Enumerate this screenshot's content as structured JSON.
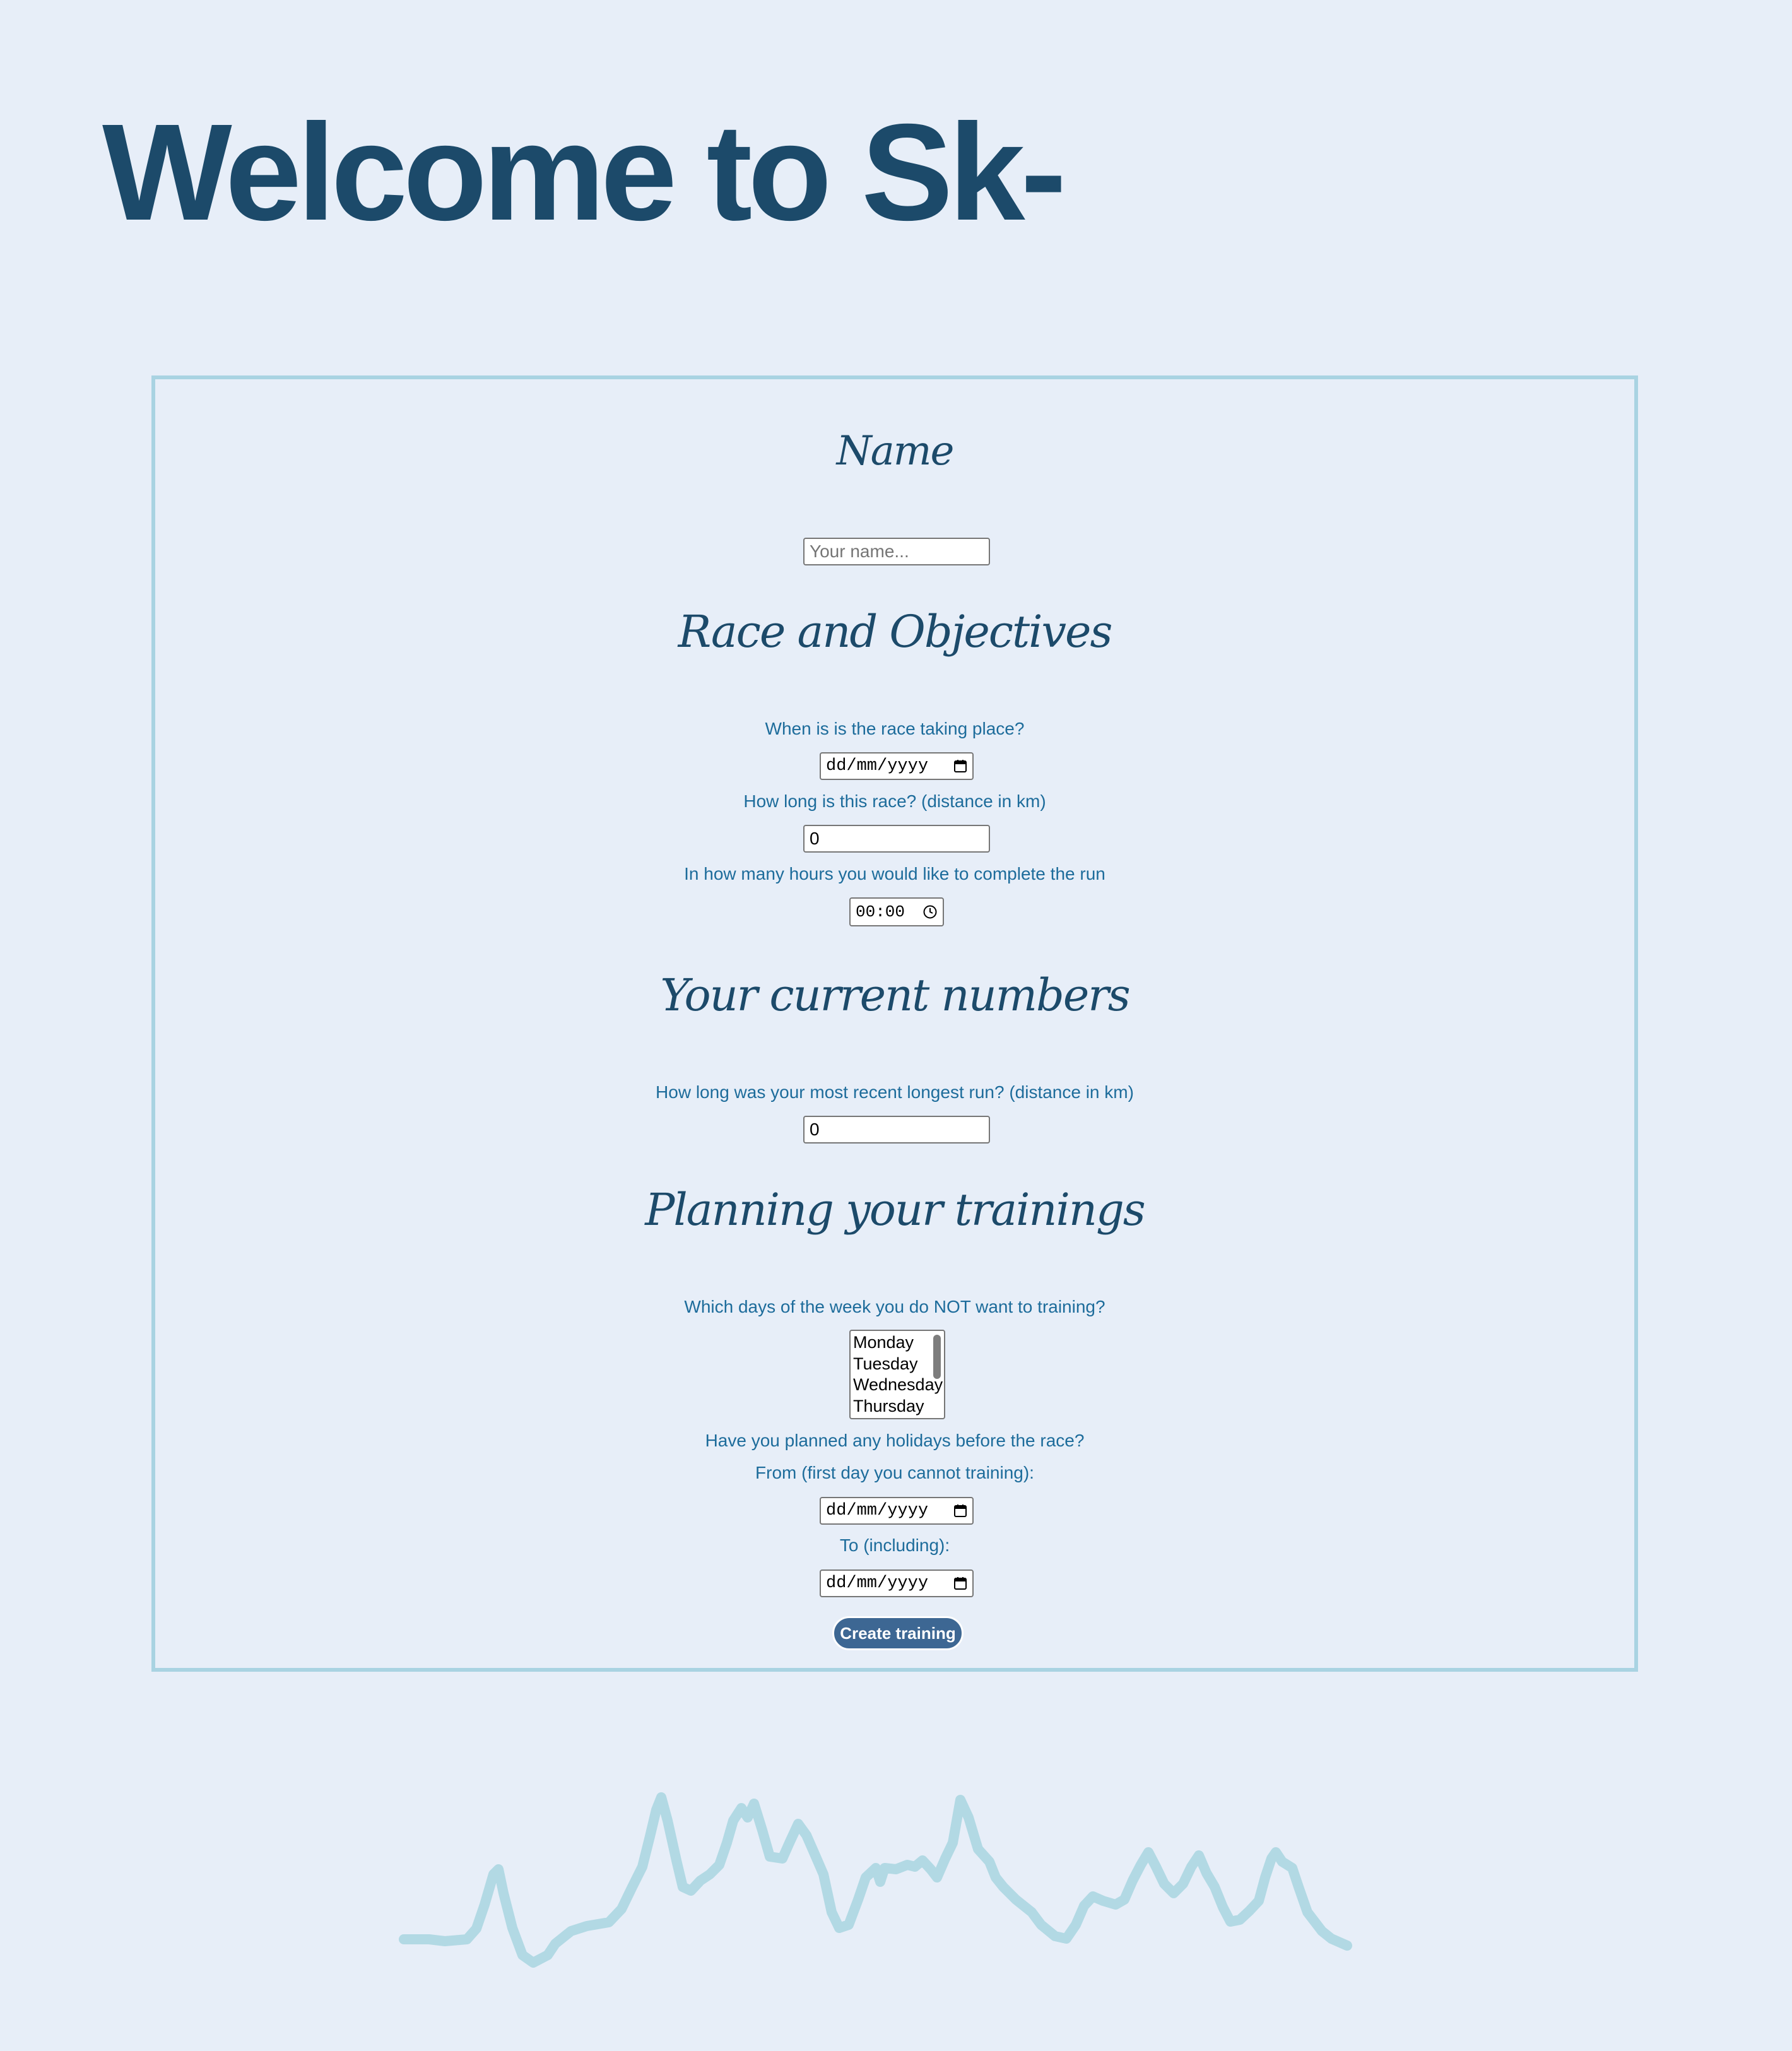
{
  "header": {
    "title": "Welcome to Sk-"
  },
  "form": {
    "name_section": {
      "heading": "Name",
      "name_placeholder": "Your name..."
    },
    "race_section": {
      "heading": "Race and Objectives",
      "date_label": "When is is the race taking place?",
      "date_value": "dd/mm/yyyy",
      "distance_label": "How long is this race? (distance in km)",
      "distance_value": "0",
      "hours_label": "In how many hours you would like to complete the run",
      "hours_value": "00:00"
    },
    "numbers_section": {
      "heading": "Your current numbers",
      "longest_run_label": "How long was your most recent longest run? (distance in km)",
      "longest_run_value": "0"
    },
    "planning_section": {
      "heading": "Planning your trainings",
      "days_label": "Which days of the week you do NOT want to training?",
      "days_options": [
        "Monday",
        "Tuesday",
        "Wednesday",
        "Thursday"
      ],
      "holidays_label": "Have you planned any holidays before the race?",
      "from_label": "From (first day you cannot training):",
      "from_value": "dd/mm/yyyy",
      "to_label": "To (including):",
      "to_value": "dd/mm/yyyy"
    },
    "submit_label": "Create training"
  },
  "decor": {
    "mountain_color": "#b2d9e4",
    "accent_color": "#1c4a6a",
    "label_color": "#1d6c9b",
    "button_color": "#3d6793"
  }
}
